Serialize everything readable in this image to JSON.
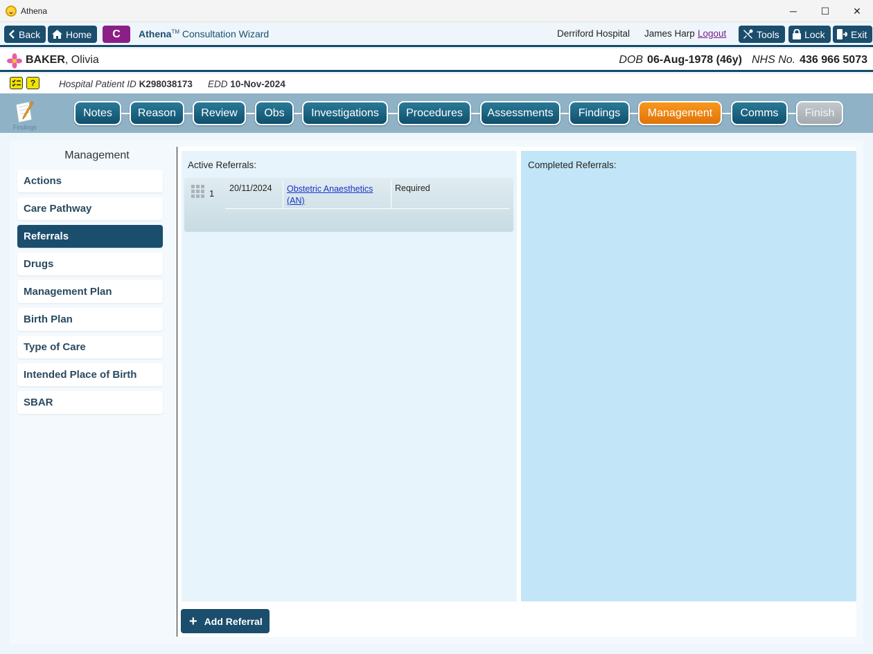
{
  "window": {
    "title": "Athena",
    "controls": {
      "minimize": "─",
      "maximize": "☐",
      "close": "✕"
    }
  },
  "toolbar": {
    "back_label": "Back",
    "home_label": "Home",
    "c_label": "C",
    "brand": "Athena",
    "trademark": "TM",
    "wizard_label": " Consultation Wizard",
    "hospital": "Derriford Hospital",
    "user": "James Harp",
    "logout_label": "Logout",
    "tools_label": "Tools",
    "lock_label": "Lock",
    "exit_label": "Exit"
  },
  "patient": {
    "surname": "BAKER",
    "forename": ", Olivia",
    "dob_label": "DOB",
    "dob_value": "06-Aug-1978 (46y)",
    "nhs_label": "NHS No.",
    "nhs_value": "436 966 5073",
    "hpid_label": "Hospital Patient ID",
    "hpid_value": "K298038173",
    "edd_label": "EDD",
    "edd_value": "10-Nov-2024"
  },
  "nav": {
    "findings_icon_label": "Findings",
    "steps": [
      "Notes",
      "Reason",
      "Review",
      "Obs",
      "Investigations",
      "Procedures",
      "Assessments",
      "Findings",
      "Management",
      "Comms",
      "Finish"
    ],
    "active": "Management"
  },
  "sidebar": {
    "title": "Management",
    "items": [
      "Actions",
      "Care Pathway",
      "Referrals",
      "Drugs",
      "Management Plan",
      "Birth Plan",
      "Type of Care",
      "Intended Place of Birth",
      "SBAR"
    ],
    "active": "Referrals"
  },
  "active_referrals": {
    "label": "Active Referrals:",
    "rows": [
      {
        "num": "1",
        "date": "20/11/2024",
        "name": "Obstetric Anaesthetics (AN)",
        "status": "Required"
      }
    ]
  },
  "completed_referrals": {
    "label": "Completed Referrals:"
  },
  "add_referral_label": "Add Referral",
  "colors": {
    "primary": "#1b4d6d",
    "accent_active": "#f28c14",
    "c_button": "#8b1f87",
    "link": "#1a33c9"
  }
}
